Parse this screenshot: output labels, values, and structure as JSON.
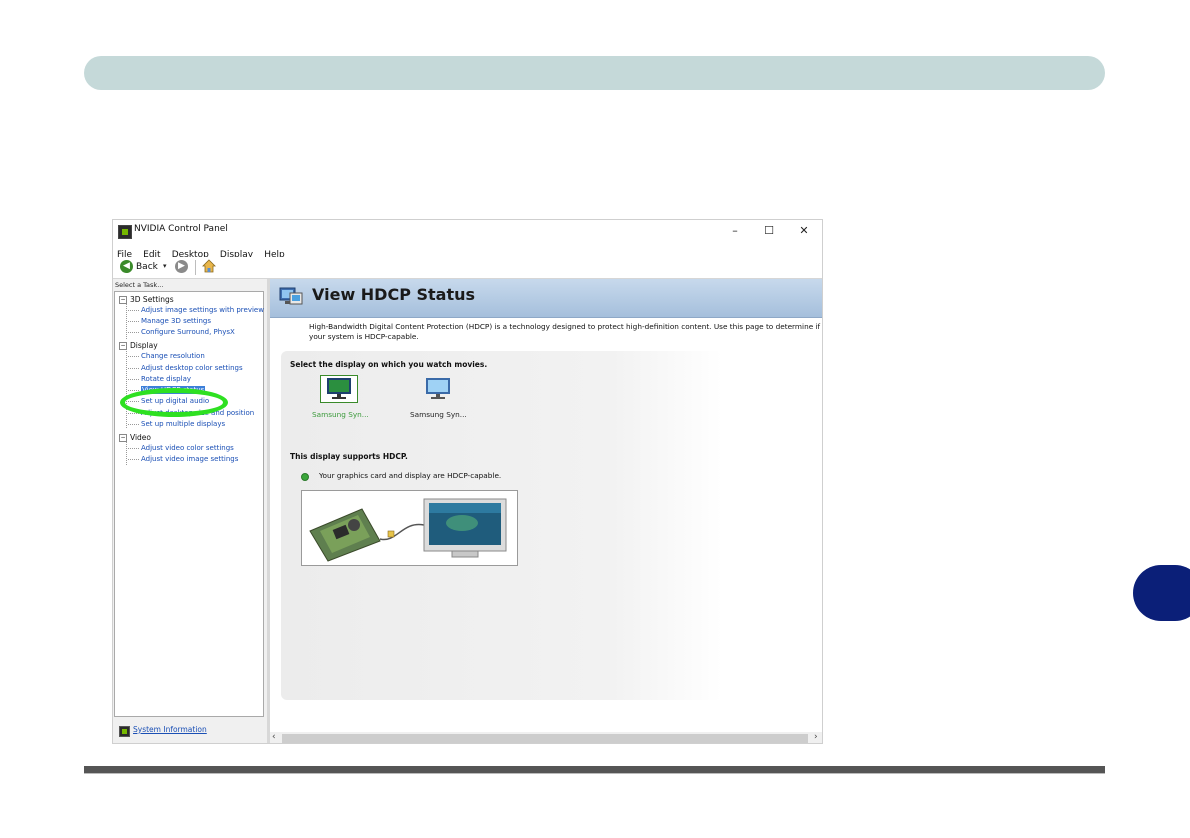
{
  "window": {
    "title": "NVIDIA Control Panel",
    "controls": {
      "minimize": "–",
      "maximize": "☐",
      "close": "✕"
    }
  },
  "menu": [
    "File",
    "Edit",
    "Desktop",
    "Display",
    "Help"
  ],
  "toolbar": {
    "back_label": "Back",
    "dropdown": "▾"
  },
  "sidebar": {
    "heading": "Select a Task...",
    "categories": [
      {
        "label": "3D Settings",
        "items": [
          "Adjust image settings with preview",
          "Manage 3D settings",
          "Configure Surround, PhysX"
        ]
      },
      {
        "label": "Display",
        "items": [
          "Change resolution",
          "Adjust desktop color settings",
          "Rotate display",
          "View HDCP status",
          "Set up digital audio",
          "Adjust desktop size and position",
          "Set up multiple displays"
        ]
      },
      {
        "label": "Video",
        "items": [
          "Adjust video color settings",
          "Adjust video image settings"
        ]
      }
    ],
    "selected_item": "View HDCP status",
    "system_information": "System Information"
  },
  "page": {
    "title": "View HDCP Status",
    "description": "High-Bandwidth Digital Content Protection (HDCP) is a technology designed to protect high-definition content. Use this page to determine if your system is HDCP-capable.",
    "select_display_label": "Select the display on which you watch movies.",
    "displays": [
      {
        "label": "Samsung Syn...",
        "selected": true
      },
      {
        "label": "Samsung Syn...",
        "selected": false
      }
    ],
    "support_heading": "This display supports HDCP.",
    "support_status": "Your graphics card and display are HDCP-capable."
  },
  "colors": {
    "accent_green": "#2ee021",
    "selection_blue": "#3d7fd9",
    "link_blue": "#1a4fb5",
    "side_tab": "#0b1f78"
  }
}
